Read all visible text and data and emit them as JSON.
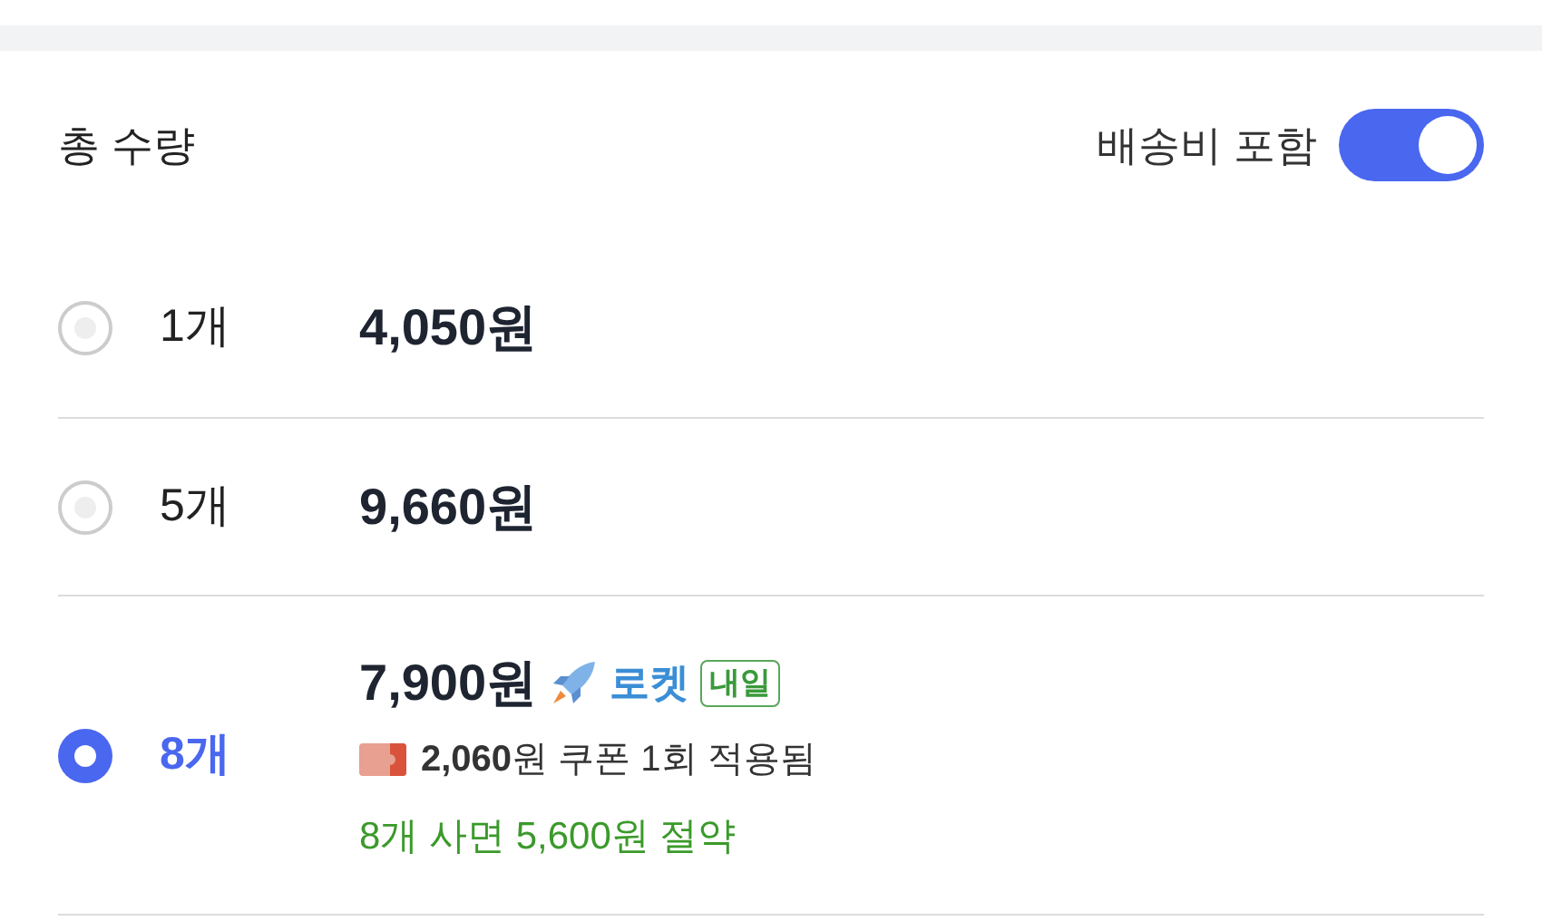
{
  "header": {
    "title": "총 수량",
    "shipping_toggle": {
      "label": "배송비 포함",
      "on": true
    }
  },
  "options": [
    {
      "quantity": "1개",
      "price": "4,050원",
      "selected": false
    },
    {
      "quantity": "5개",
      "price": "9,660원",
      "selected": false
    },
    {
      "quantity": "8개",
      "price": "7,900원",
      "selected": true,
      "delivery": {
        "label": "로켓",
        "badge": "내일"
      },
      "coupon": "**2,060**원 쿠폰 1회 적용됨",
      "savings": "8개 사면 5,600원 절약"
    }
  ]
}
